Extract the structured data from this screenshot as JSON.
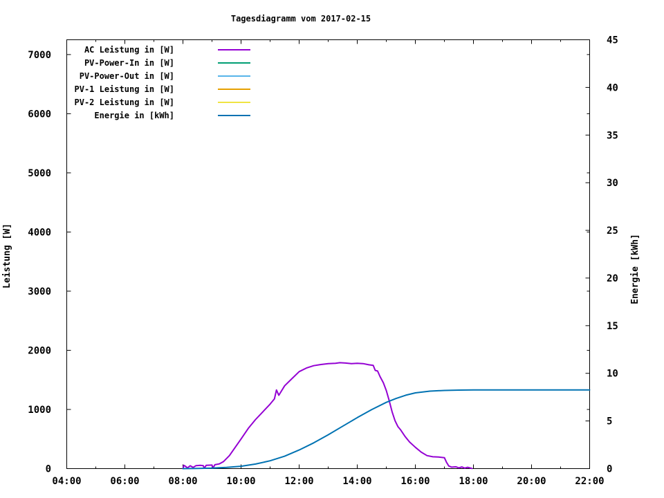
{
  "title": "Tagesdiagramm vom 2017-02-15",
  "colors": {
    "background": "#ffffff",
    "foreground": "#000000",
    "ac_leistung": "#9400d3",
    "pv_power_in": "#009e73",
    "pv_power_out": "#56b4e9",
    "pv1_leistung": "#e69f00",
    "pv2_leistung": "#f0e442",
    "energie": "#0072b2"
  },
  "chart_data": {
    "type": "line",
    "title": "Tagesdiagramm vom 2017-02-15",
    "grid": false,
    "legend_position": "inside-top-left",
    "x_axis": {
      "label": "",
      "unit": "time-of-day",
      "range_hours": [
        4,
        22
      ],
      "major_hours": [
        4,
        6,
        8,
        10,
        12,
        14,
        16,
        18,
        20,
        22
      ],
      "tick_labels": [
        "04:00",
        "06:00",
        "08:00",
        "10:00",
        "12:00",
        "14:00",
        "16:00",
        "18:00",
        "20:00",
        "22:00"
      ],
      "minor_hours": [
        5,
        7,
        9,
        11,
        13,
        15,
        17,
        19,
        21
      ]
    },
    "y_axis_left": {
      "label": "Leistung [W]",
      "range": [
        0,
        7250
      ],
      "tick_values": [
        0,
        1000,
        2000,
        3000,
        4000,
        5000,
        6000,
        7000
      ],
      "tick_labels": [
        "0",
        "1000",
        "2000",
        "3000",
        "4000",
        "5000",
        "6000",
        "7000"
      ]
    },
    "y_axis_right": {
      "label": "Energie [kWh]",
      "range": [
        0,
        45
      ],
      "tick_values": [
        0,
        5,
        10,
        15,
        20,
        25,
        30,
        35,
        40,
        45
      ],
      "tick_labels": [
        "0",
        "5",
        "10",
        "15",
        "20",
        "25",
        "30",
        "35",
        "40",
        "45"
      ]
    },
    "series": [
      {
        "name": "AC Leistung in [W]",
        "color": "#9400d3",
        "axis": "left",
        "visible_in_plot": true,
        "x": [
          8.0,
          8.03,
          8.1,
          8.15,
          8.25,
          8.35,
          8.45,
          8.6,
          8.7,
          8.73,
          8.8,
          9.0,
          9.03,
          9.1,
          9.25,
          9.4,
          9.6,
          9.8,
          10.0,
          10.25,
          10.5,
          10.75,
          11.0,
          11.15,
          11.22,
          11.3,
          11.5,
          11.75,
          12.0,
          12.25,
          12.5,
          12.75,
          13.0,
          13.25,
          13.4,
          13.6,
          13.8,
          14.0,
          14.2,
          14.4,
          14.55,
          14.62,
          14.7,
          14.78,
          14.9,
          15.0,
          15.1,
          15.2,
          15.3,
          15.4,
          15.5,
          15.65,
          15.8,
          16.0,
          16.2,
          16.4,
          16.6,
          16.8,
          17.0,
          17.07,
          17.15,
          17.25,
          17.4,
          17.5,
          17.6,
          17.7,
          17.8,
          17.95
        ],
        "y": [
          0,
          55,
          35,
          12,
          48,
          20,
          50,
          55,
          50,
          6,
          55,
          60,
          8,
          65,
          80,
          120,
          220,
          360,
          500,
          680,
          830,
          960,
          1090,
          1180,
          1330,
          1240,
          1400,
          1520,
          1640,
          1700,
          1740,
          1760,
          1775,
          1780,
          1790,
          1785,
          1775,
          1780,
          1775,
          1755,
          1745,
          1660,
          1650,
          1560,
          1450,
          1320,
          1150,
          960,
          810,
          710,
          650,
          540,
          450,
          360,
          280,
          220,
          200,
          195,
          185,
          110,
          45,
          25,
          30,
          12,
          28,
          8,
          22,
          2
        ]
      },
      {
        "name": "PV-Power-In in [W]",
        "color": "#009e73",
        "axis": "left",
        "visible_in_plot": false,
        "x": [],
        "y": []
      },
      {
        "name": "PV-Power-Out in [W]",
        "color": "#56b4e9",
        "axis": "left",
        "visible_in_plot": false,
        "x": [],
        "y": []
      },
      {
        "name": "PV-1 Leistung in [W]",
        "color": "#e69f00",
        "axis": "left",
        "visible_in_plot": false,
        "x": [],
        "y": []
      },
      {
        "name": "PV-2 Leistung in [W]",
        "color": "#f0e442",
        "axis": "left",
        "visible_in_plot": false,
        "x": [],
        "y": []
      },
      {
        "name": "Energie in [kWh]",
        "color": "#0072b2",
        "axis": "right",
        "visible_in_plot": true,
        "x": [
          8.0,
          8.5,
          9.0,
          9.5,
          10.0,
          10.5,
          11.0,
          11.5,
          12.0,
          12.5,
          13.0,
          13.5,
          14.0,
          14.5,
          15.0,
          15.33,
          15.67,
          16.0,
          16.5,
          17.0,
          17.5,
          18.0,
          22.0
        ],
        "y": [
          0,
          0.02,
          0.06,
          0.13,
          0.25,
          0.48,
          0.82,
          1.3,
          1.95,
          2.7,
          3.55,
          4.45,
          5.35,
          6.2,
          6.95,
          7.35,
          7.7,
          7.95,
          8.13,
          8.2,
          8.24,
          8.25,
          8.25
        ]
      }
    ]
  }
}
